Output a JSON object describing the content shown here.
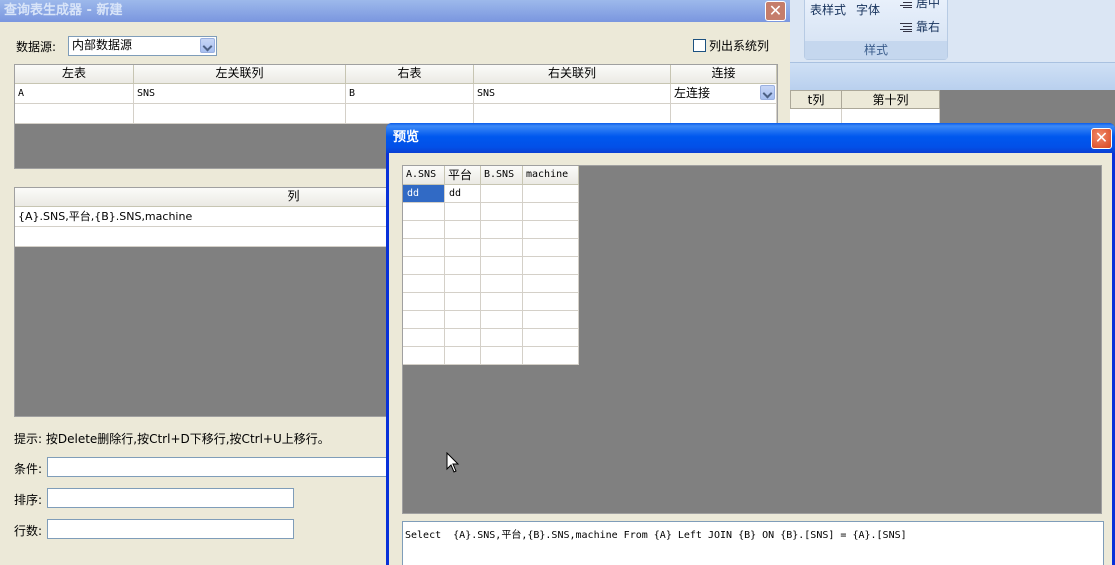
{
  "background_app": {
    "ribbon": {
      "table_style_label": "表样式",
      "font_label": "字体",
      "center_label": "居中",
      "right_align_label": "靠右",
      "group_label": "样式"
    },
    "grid_headers": [
      "t列",
      "第十列"
    ]
  },
  "main_dialog": {
    "title": "查询表生成器 - 新建",
    "close_glyph": "✕",
    "datasource": {
      "label": "数据源:",
      "value": "内部数据源"
    },
    "show_system_columns": {
      "label": "列出系统列",
      "checked": false
    },
    "join_grid": {
      "headers": [
        "左表",
        "左关联列",
        "右表",
        "右关联列",
        "连接"
      ],
      "rows": [
        [
          "A",
          "SNS",
          "B",
          "SNS",
          "左连接"
        ],
        [
          "",
          "",
          "",
          "",
          ""
        ]
      ]
    },
    "column_grid": {
      "header": "列",
      "rows": [
        "{A}.SNS,平台,{B}.SNS,machine",
        ""
      ]
    },
    "hint": "提示: 按Delete删除行,按Ctrl+D下移行,按Ctrl+U上移行。",
    "condition": {
      "label": "条件:",
      "value": ""
    },
    "sort": {
      "label": "排序:",
      "value": ""
    },
    "row_count": {
      "label": "行数:",
      "value": ""
    }
  },
  "preview_window": {
    "title": "预览",
    "close_glyph": "✕",
    "result_grid": {
      "headers": [
        "A.SNS",
        "平台",
        "B.SNS",
        "machine"
      ],
      "rows": [
        [
          "dd",
          "dd",
          "",
          ""
        ]
      ],
      "empty_rows": 9
    },
    "sql": "Select  {A}.SNS,平台,{B}.SNS,machine From {A} Left JOIN {B} ON {B}.[SNS] = {A}.[SNS]"
  },
  "colors": {
    "dialog_bg": "#ece9d8",
    "active_title": "#0058ee",
    "inactive_title": "#8aa6e4",
    "selection": "#316ac5",
    "grid_empty": "#808080"
  }
}
